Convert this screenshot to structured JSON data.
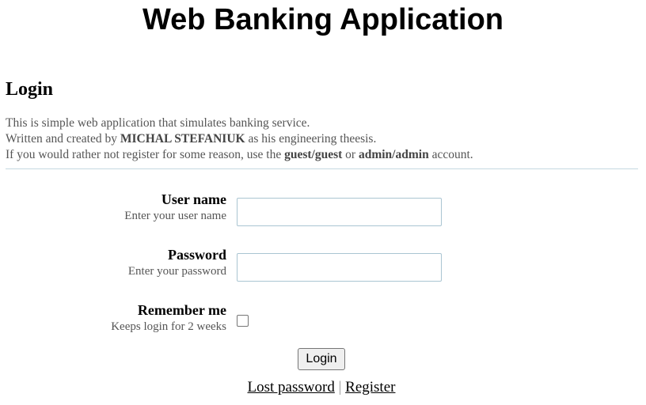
{
  "app": {
    "title": "Web Banking Application"
  },
  "login": {
    "heading": "Login",
    "intro": {
      "line1": "This is simple web application that simulates banking service.",
      "line2_prefix": "Written and created by ",
      "line2_author": "MICHAL STEFANIUK",
      "line2_suffix": " as his engineering theesis.",
      "line3_prefix": "If you would rather not register for some reason, use the ",
      "line3_guest": "guest/guest",
      "line3_middle": " or ",
      "line3_admin": "admin/admin",
      "line3_suffix": " account."
    },
    "username": {
      "label": "User name",
      "hint": "Enter your user name",
      "value": "",
      "placeholder": ""
    },
    "password": {
      "label": "Password",
      "hint": "Enter your password",
      "value": "",
      "placeholder": ""
    },
    "remember": {
      "label": "Remember me",
      "hint": "Keeps login for 2 weeks",
      "checked": false
    },
    "submit_label": "Login",
    "links": {
      "lost_password": "Lost password",
      "separator": "|",
      "register": "Register"
    }
  },
  "colors": {
    "hint_text": "#555555",
    "input_border": "#aac5d2",
    "divider": "#c5d8e0"
  }
}
